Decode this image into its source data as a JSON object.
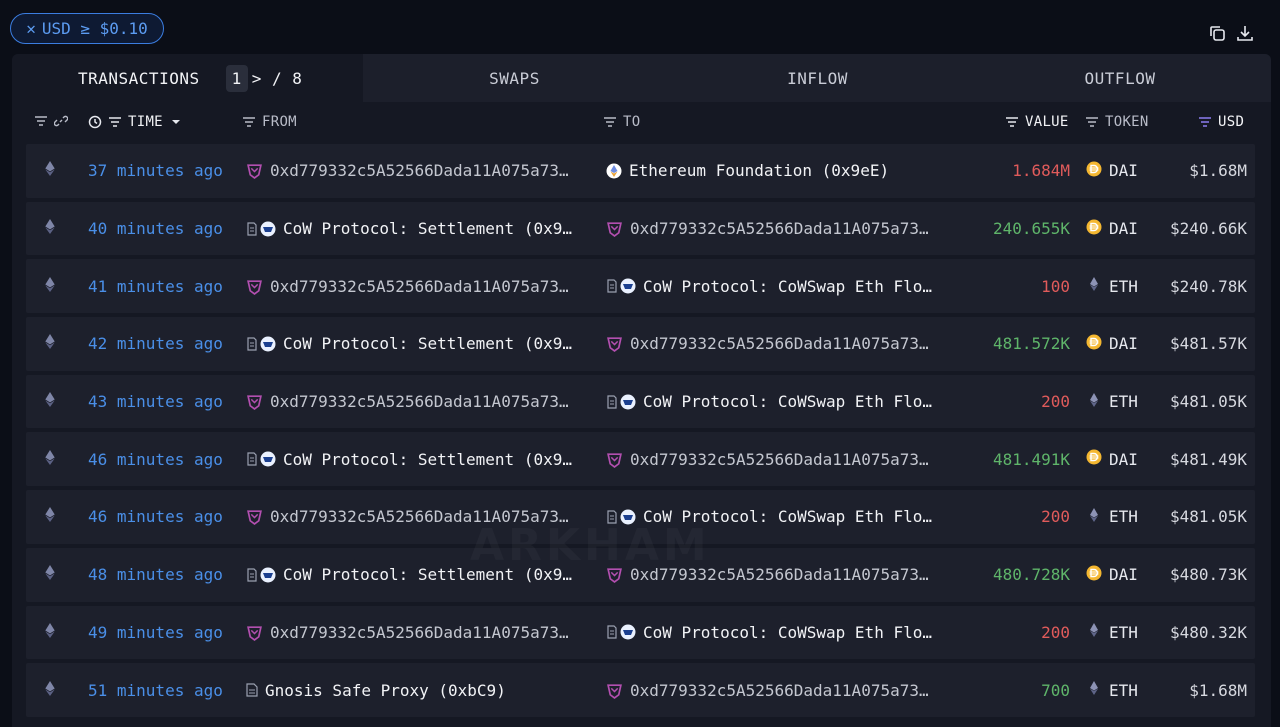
{
  "filter": {
    "label": "USD ≥ $0.10"
  },
  "tabs": {
    "transactions": "TRANSACTIONS",
    "page_current": "1",
    "page_rest": "> / 8",
    "swaps": "SWAPS",
    "inflow": "INFLOW",
    "outflow": "OUTFLOW"
  },
  "columns": {
    "time": "TIME",
    "from": "FROM",
    "to": "TO",
    "value": "VALUE",
    "token": "TOKEN",
    "usd": "USD"
  },
  "watermark": "ARKHAM",
  "colors": {
    "accent": "#4a8fe8",
    "negative": "#e05b5b",
    "positive": "#5fb56a"
  },
  "rows": [
    {
      "time": "37 minutes ago",
      "from": "0xd779332c5A52566Dada11A075a73…",
      "from_type": "wallet",
      "to": "Ethereum Foundation (0x9eE)",
      "to_type": "ef",
      "value": "1.684M",
      "dir": "neg",
      "token": "DAI",
      "usd": "$1.68M"
    },
    {
      "time": "40 minutes ago",
      "from": "CoW Protocol: Settlement (0x9…",
      "from_type": "cow",
      "to": "0xd779332c5A52566Dada11A075a73…",
      "to_type": "wallet",
      "value": "240.655K",
      "dir": "pos",
      "token": "DAI",
      "usd": "$240.66K"
    },
    {
      "time": "41 minutes ago",
      "from": "0xd779332c5A52566Dada11A075a73…",
      "from_type": "wallet",
      "to": "CoW Protocol: CoWSwap Eth Flo…",
      "to_type": "cow",
      "value": "100",
      "dir": "neg",
      "token": "ETH",
      "usd": "$240.78K"
    },
    {
      "time": "42 minutes ago",
      "from": "CoW Protocol: Settlement (0x9…",
      "from_type": "cow",
      "to": "0xd779332c5A52566Dada11A075a73…",
      "to_type": "wallet",
      "value": "481.572K",
      "dir": "pos",
      "token": "DAI",
      "usd": "$481.57K"
    },
    {
      "time": "43 minutes ago",
      "from": "0xd779332c5A52566Dada11A075a73…",
      "from_type": "wallet",
      "to": "CoW Protocol: CoWSwap Eth Flo…",
      "to_type": "cow",
      "value": "200",
      "dir": "neg",
      "token": "ETH",
      "usd": "$481.05K"
    },
    {
      "time": "46 minutes ago",
      "from": "CoW Protocol: Settlement (0x9…",
      "from_type": "cow",
      "to": "0xd779332c5A52566Dada11A075a73…",
      "to_type": "wallet",
      "value": "481.491K",
      "dir": "pos",
      "token": "DAI",
      "usd": "$481.49K"
    },
    {
      "time": "46 minutes ago",
      "from": "0xd779332c5A52566Dada11A075a73…",
      "from_type": "wallet",
      "to": "CoW Protocol: CoWSwap Eth Flo…",
      "to_type": "cow",
      "value": "200",
      "dir": "neg",
      "token": "ETH",
      "usd": "$481.05K"
    },
    {
      "time": "48 minutes ago",
      "from": "CoW Protocol: Settlement (0x9…",
      "from_type": "cow",
      "to": "0xd779332c5A52566Dada11A075a73…",
      "to_type": "wallet",
      "value": "480.728K",
      "dir": "pos",
      "token": "DAI",
      "usd": "$480.73K"
    },
    {
      "time": "49 minutes ago",
      "from": "0xd779332c5A52566Dada11A075a73…",
      "from_type": "wallet",
      "to": "CoW Protocol: CoWSwap Eth Flo…",
      "to_type": "cow",
      "value": "200",
      "dir": "neg",
      "token": "ETH",
      "usd": "$480.32K"
    },
    {
      "time": "51 minutes ago",
      "from": "Gnosis Safe Proxy (0xbC9)",
      "from_type": "gnosis",
      "to": "0xd779332c5A52566Dada11A075a73…",
      "to_type": "wallet",
      "value": "700",
      "dir": "pos",
      "token": "ETH",
      "usd": "$1.68M"
    }
  ]
}
